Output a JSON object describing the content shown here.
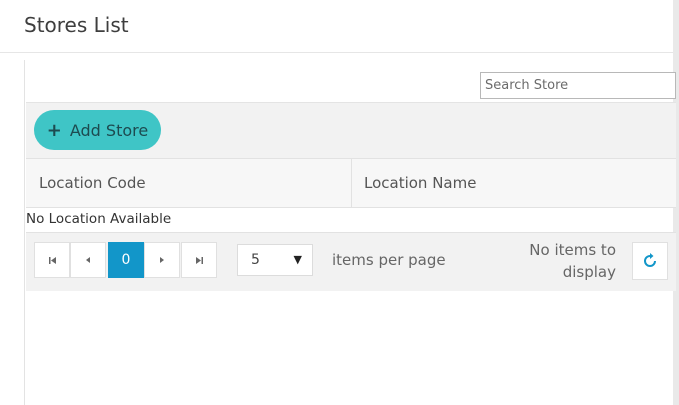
{
  "window": {
    "title": "Stores List"
  },
  "search": {
    "placeholder": "Search Store",
    "value": ""
  },
  "toolbar": {
    "add_label": "Add Store"
  },
  "table": {
    "columns": [
      "Location Code",
      "Location Name"
    ],
    "empty_text": "No Location Available"
  },
  "pager": {
    "current_page": "0",
    "page_size": "5",
    "items_per_page_label": "items per page",
    "status_line1": "No items to",
    "status_line2": "display"
  },
  "colors": {
    "accent": "#3fc5c6",
    "active_page": "#1296c9",
    "refresh_icon": "#1296c9"
  },
  "icons": {
    "add": "plus-icon",
    "first": "first-page-icon",
    "prev": "prev-page-icon",
    "next": "next-page-icon",
    "last": "last-page-icon",
    "dropdown": "caret-down-icon",
    "refresh": "refresh-icon"
  }
}
